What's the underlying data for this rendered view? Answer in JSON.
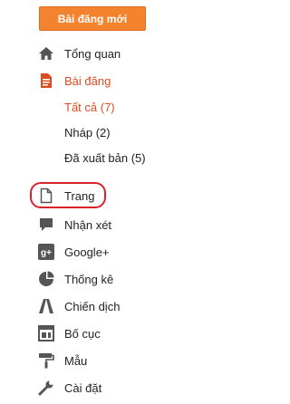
{
  "new_post_button": "Bài đăng mới",
  "nav": {
    "overview": "Tổng quan",
    "posts": "Bài đăng",
    "posts_sub": {
      "all": "Tất cả (7)",
      "drafts": "Nháp (2)",
      "published": "Đã xuất bản (5)"
    },
    "pages": "Trang",
    "comments": "Nhận xét",
    "google_plus": "Google+",
    "stats": "Thống kê",
    "campaigns": "Chiến dịch",
    "layout": "Bố cục",
    "template": "Mẫu",
    "settings": "Cài đặt"
  },
  "colors": {
    "accent": "#f4832f",
    "active_text": "#dd4b1f",
    "icon": "#555555",
    "highlight_ring": "#d8232a"
  }
}
